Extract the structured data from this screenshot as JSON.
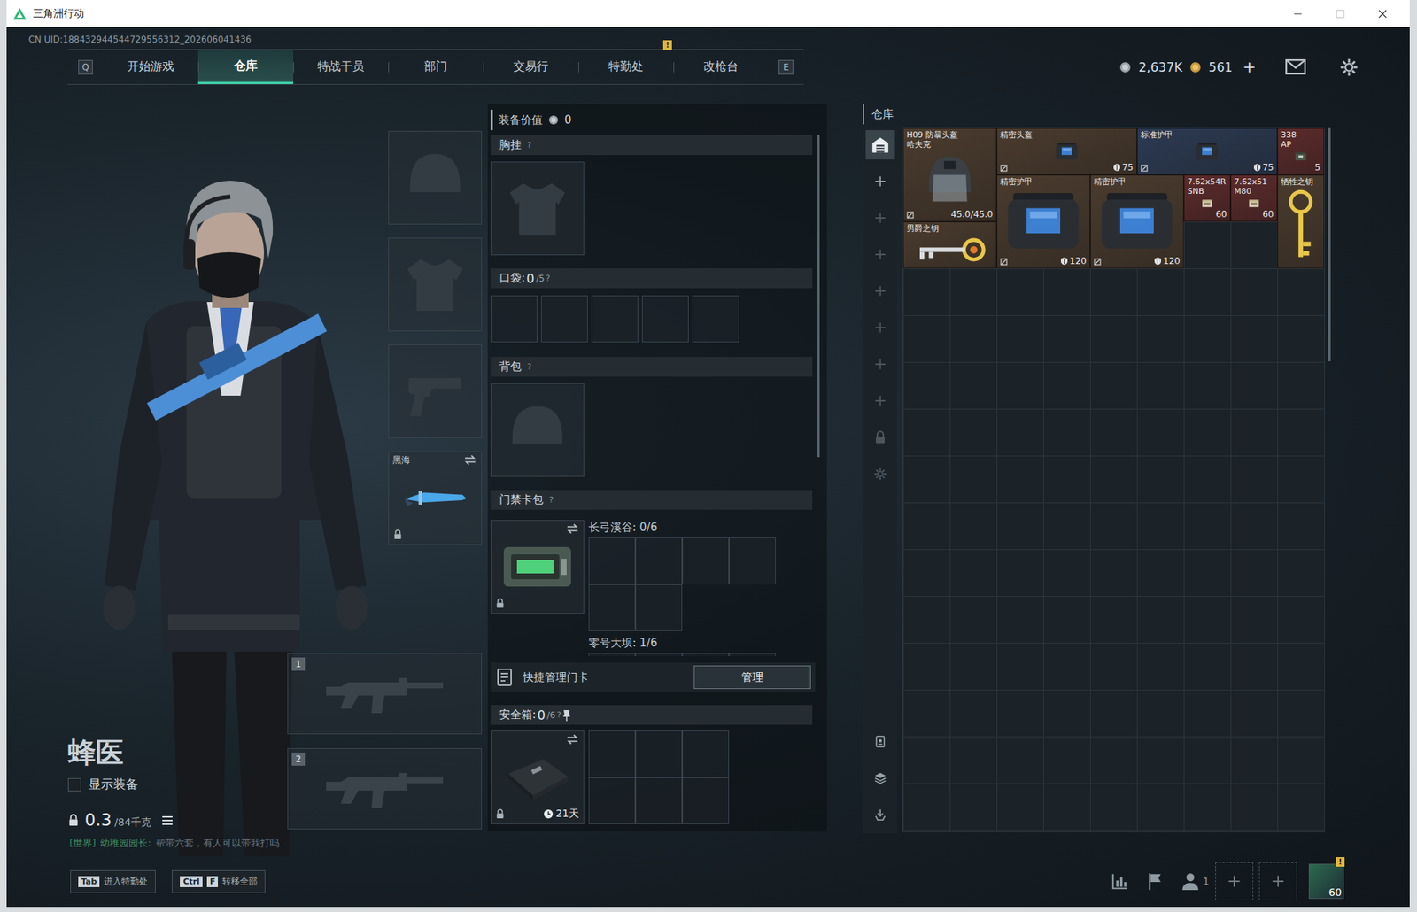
{
  "window": {
    "title": "三角洲行动"
  },
  "uid": "CN UID:188432944544729556312_202606041436",
  "nav": {
    "left_key": "Q",
    "right_key": "E",
    "alert_badge": "!",
    "tabs": [
      {
        "label": "开始游戏",
        "selected": false,
        "alert": false
      },
      {
        "label": "仓库",
        "selected": true,
        "alert": false
      },
      {
        "label": "特战干员",
        "selected": false,
        "alert": false
      },
      {
        "label": "部门",
        "selected": false,
        "alert": false
      },
      {
        "label": "交易行",
        "selected": false,
        "alert": false
      },
      {
        "label": "特勤处",
        "selected": false,
        "alert": true
      },
      {
        "label": "改枪台",
        "selected": false,
        "alert": false
      }
    ]
  },
  "currency": {
    "coins": "2,637K",
    "tickets": "561",
    "add": "+"
  },
  "operator": {
    "name": "蜂医",
    "show_equipment": {
      "label": "显示装备",
      "checked": false
    },
    "weight": "0.3",
    "weight_max": "/84千克"
  },
  "gear": {
    "melee": {
      "label": "黑海",
      "locked": true
    },
    "weapon_slots": [
      "1",
      "2"
    ]
  },
  "chat": {
    "channel": "[世界]",
    "sender": "幼稚园园长:",
    "message": "帮带六套，有人可以带我打吗"
  },
  "loadout": {
    "value_label": "装备价值",
    "value": "0",
    "help": "?",
    "chest": {
      "label": "胸挂"
    },
    "pocket": {
      "label": "口袋:",
      "count": "0",
      "max": "/5"
    },
    "backpack": {
      "label": "背包"
    },
    "keycards": {
      "label": "门禁卡包",
      "locked": true,
      "maps": [
        {
          "label": "长弓溪谷: 0/6"
        },
        {
          "label": "零号大坝: 1/6"
        }
      ]
    },
    "quick_manage": {
      "label": "快捷管理门卡",
      "button": "管理"
    },
    "safe": {
      "label": "安全箱:",
      "count": "0",
      "max": "/6",
      "timer": "21天",
      "locked": true
    }
  },
  "warehouse": {
    "title": "仓库",
    "sidebar": [
      {
        "kind": "home",
        "selected": true,
        "disabled": false
      },
      {
        "kind": "add",
        "selected": false,
        "disabled": false
      },
      {
        "kind": "add",
        "selected": false,
        "disabled": true
      },
      {
        "kind": "add",
        "selected": false,
        "disabled": true
      },
      {
        "kind": "add",
        "selected": false,
        "disabled": true
      },
      {
        "kind": "add",
        "selected": false,
        "disabled": true
      },
      {
        "kind": "add",
        "selected": false,
        "disabled": true
      },
      {
        "kind": "add",
        "selected": false,
        "disabled": true
      },
      {
        "kind": "lock",
        "selected": false,
        "disabled": true
      },
      {
        "kind": "gear",
        "selected": false,
        "disabled": true
      },
      {
        "kind": "sort",
        "selected": false,
        "disabled": false
      },
      {
        "kind": "stack",
        "selected": false,
        "disabled": false
      },
      {
        "kind": "transfer",
        "selected": false,
        "disabled": false
      }
    ],
    "items": [
      {
        "name": "H09 防暴头盔",
        "sub": "哈夫克",
        "value": "45.0/45.0",
        "kind": "helmet",
        "color": "#4a3b2e"
      },
      {
        "name": "精密头盔",
        "value": "75",
        "kind": "armor",
        "color": "#4a3b2e"
      },
      {
        "name": "标准护甲",
        "value": "75",
        "kind": "armor",
        "color": "#2c3a52"
      },
      {
        "name": "338",
        "sub": "AP",
        "value": "5",
        "kind": "ammobox",
        "color": "#5c2b2b"
      },
      {
        "name": "精密护甲",
        "value": "120",
        "kind": "armor",
        "color": "#4a3b2e"
      },
      {
        "name": "精密护甲",
        "value": "120",
        "kind": "armor",
        "color": "#4a3b2e"
      },
      {
        "name": "7.62x54R",
        "sub": "SNB",
        "value": "60",
        "kind": "ammo",
        "color": "#5c2b2b"
      },
      {
        "name": "7.62x51",
        "sub": "M80",
        "value": "60",
        "kind": "ammo",
        "color": "#5c2b2b"
      },
      {
        "name": "牺牲之钥",
        "kind": "key",
        "color": "#4a3b2e"
      },
      {
        "name": "男爵之钥",
        "kind": "key",
        "color": "#4a3b2e"
      }
    ]
  },
  "shortcuts": [
    {
      "keys": [
        "Tab"
      ],
      "label": "进入特勤处"
    },
    {
      "keys": [
        "Ctrl",
        "F"
      ],
      "label": "转移全部"
    }
  ],
  "social": {
    "friends": "1",
    "level": "60",
    "alert": "!"
  }
}
